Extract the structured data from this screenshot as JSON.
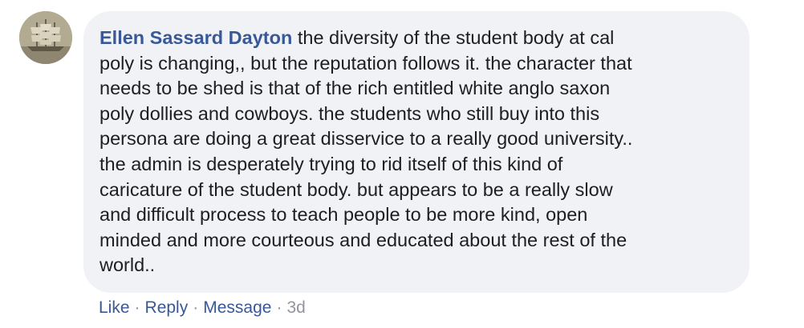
{
  "comment": {
    "author": "Ellen Sassard Dayton",
    "avatar_icon": "ship-photo-avatar",
    "lines": [
      "the diversity of the student body at cal",
      "poly is changing,, but the reputation follows it. the character that",
      "needs to be shed is that of the rich entitled white anglo saxon",
      "poly dollies and cowboys. the students who still buy into this",
      "persona are doing a great disservice to a really good university..",
      "the admin is desperately trying to rid itself of this kind of",
      "caricature of the student body. but appears to be a really slow",
      "and difficult process to teach people to be more kind, open",
      "minded and more courteous and educated about the rest of the",
      "world.."
    ],
    "bubble_color": "#f0f2f5",
    "author_color": "#385898"
  },
  "actions": {
    "like_label": "Like",
    "reply_label": "Reply",
    "message_label": "Message",
    "separator": "·",
    "timestamp": "3d"
  }
}
